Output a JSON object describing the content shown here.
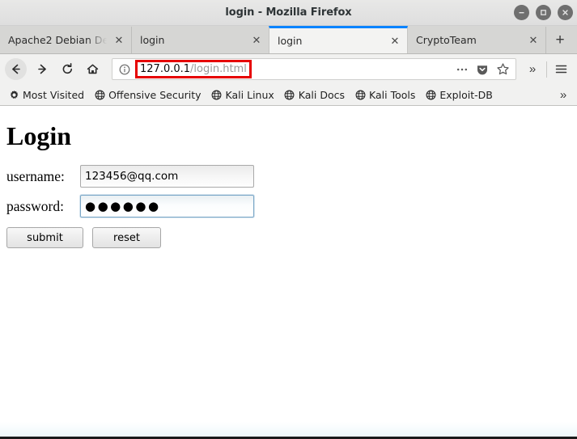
{
  "window": {
    "title": "login - Mozilla Firefox",
    "controls": [
      {
        "name": "minimize-button",
        "glyph": "−"
      },
      {
        "name": "maximize-button",
        "glyph": "□"
      },
      {
        "name": "close-button",
        "glyph": "✕"
      }
    ]
  },
  "tabs": [
    {
      "label": "Apache2 Debian De",
      "active": false,
      "close": "✕"
    },
    {
      "label": "login",
      "active": false,
      "close": "✕"
    },
    {
      "label": "login",
      "active": true,
      "close": "✕"
    },
    {
      "label": "CryptoTeam",
      "active": false,
      "close": "✕"
    }
  ],
  "new_tab_label": "+",
  "toolbar": {
    "back_label": "←",
    "forward_label": "→",
    "reload_label": "⟳",
    "home_label": "⌂",
    "page_actions_label": "•••",
    "overflow_label": "»",
    "menu_label": "≡"
  },
  "urlbar": {
    "host": "127.0.0.1",
    "path": "/login.html",
    "highlight_color": "#e60000",
    "identity_icon": "ⓘ"
  },
  "bookmarks": {
    "items": [
      {
        "label": "Most Visited",
        "icon": "gear-icon"
      },
      {
        "label": "Offensive Security",
        "icon": "globe-icon"
      },
      {
        "label": "Kali Linux",
        "icon": "globe-icon"
      },
      {
        "label": "Kali Docs",
        "icon": "globe-icon"
      },
      {
        "label": "Kali Tools",
        "icon": "globe-icon"
      },
      {
        "label": "Exploit-DB",
        "icon": "globe-icon"
      }
    ],
    "overflow_label": "»"
  },
  "page": {
    "heading": "Login",
    "fields": [
      {
        "label": "username:",
        "value": "123456@qq.com",
        "type": "text",
        "focused": false
      },
      {
        "label": "password:",
        "value": "●●●●●●",
        "type": "password",
        "focused": true
      }
    ],
    "buttons": [
      {
        "label": "submit",
        "name": "submit-button"
      },
      {
        "label": "reset",
        "name": "reset-button"
      }
    ]
  }
}
